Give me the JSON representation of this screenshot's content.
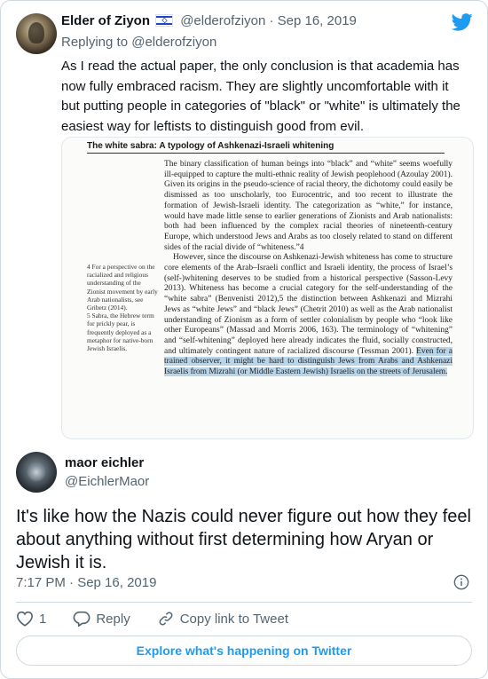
{
  "quoted_tweet": {
    "author_name": "Elder of Ziyon",
    "handle": "@elderofziyon",
    "separator": "·",
    "date": "Sep 16, 2019",
    "replying_to": "Replying to @elderofziyon",
    "text": "As I read the actual paper, the only conclusion is that academia has now fully embraced racism. They are slightly uncomfortable with it but putting people in categories of \"black\" or \"white\" is ultimately the easiest way for leftists to distinguish good from evil."
  },
  "paper_image": {
    "title": "The white sabra: A typology of Ashkenazi-Israeli whitening",
    "paragraph1": "The binary classification of human beings into “black” and “white” seems woefully ill-equipped to capture the multi-ethnic reality of Jewish peoplehood (Azoulay 2001). Given its origins in the pseudo-science of racial theory, the dichotomy could easily be dismissed as too unscholarly, too Eurocentric, and too recent to illustrate the formation of Jewish-Israeli identity. The categorization as “white,” for instance, would have made little sense to earlier generations of Zionists and Arab nationalists: both had been influenced by the complex racial theories of nineteenth-century Europe, which understood Jews and Arabs as too closely related to stand on different sides of the racial divide of “whiteness.”4",
    "paragraph2": "However, since the discourse on Ashkenazi-Jewish whiteness has come to structure core elements of the Arab–Israeli conflict and Israeli identity, the process of Israel’s (self-)whitening deserves to be studied from a historical perspective (Sasson-Levy 2013). Whiteness has become a crucial category for the self-understanding of the “white sabra” (Benvenisti 2012),5 the distinction between Ashkenazi and Mizrahi Jews as “white Jews” and “black Jews” (Chetrit 2010) as well as the Arab nationalist understanding of Zionism as a form of settler colonialism by people who “look like other Europeans” (Massad and Morris 2006, 163). The terminology of “whitening” and “self-whitening” deployed here already indicates the fluid, socially constructed, and ultimately contingent nature of racialized discourse (Tessman 2001).",
    "highlighted": "Even for a trained observer, it might be hard to distinguish Jews from Arabs and Ashkenazi Israelis from Mizrahi (or Middle Eastern Jewish) Israelis on the streets of Jerusalem.",
    "footnote4": "4 For a perspective on the racialized and religious understanding of the Zionist movement by early Arab nationalists, see Gribetz (2014).",
    "footnote5": "5 Sabra, the Hebrew term for prickly pear, is frequently deployed as a metaphor for native-born Jewish Israelis."
  },
  "reply_tweet": {
    "author_name": "maor eichler",
    "handle": "@EichlerMaor",
    "text": "It's like how the Nazis could never figure out how they feel about anything without first determining how Aryan or Jewish it is.",
    "timestamp": "7:17 PM · Sep 16, 2019"
  },
  "actions": {
    "like_count": "1",
    "reply_label": "Reply",
    "copy_link_label": "Copy link to Tweet"
  },
  "footer": {
    "explore_label": "Explore what's happening on Twitter"
  },
  "icons": {
    "brand": "twitter-bird-icon",
    "info": "info-icon",
    "like": "heart-icon",
    "reply": "reply-bubble-icon",
    "link": "link-icon"
  },
  "colors": {
    "accent": "#1d9bf0",
    "secondary_text": "#536471",
    "highlight": "#b9d5ea"
  }
}
